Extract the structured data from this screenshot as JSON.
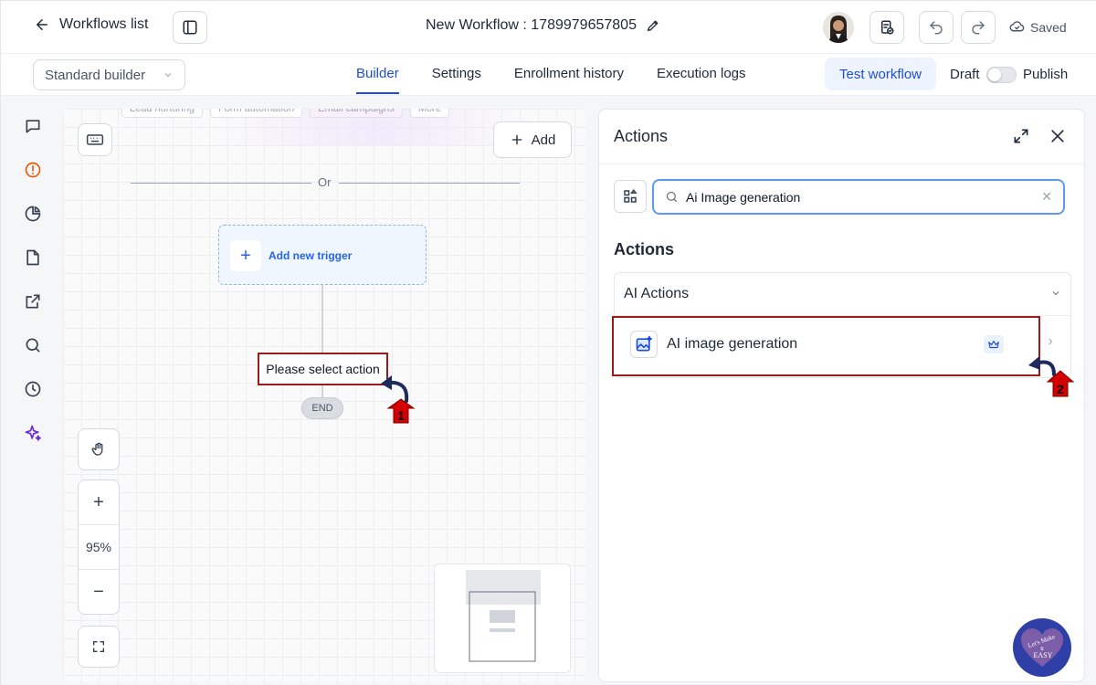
{
  "header": {
    "back_label": "Workflows list",
    "workflow_title": "New Workflow : 1789979657805",
    "saved_label": "Saved"
  },
  "subbar": {
    "builder_select": "Standard builder",
    "tabs": [
      {
        "label": "Builder",
        "active": true
      },
      {
        "label": "Settings",
        "active": false
      },
      {
        "label": "Enrollment history",
        "active": false
      },
      {
        "label": "Execution logs",
        "active": false
      }
    ],
    "test_button": "Test workflow",
    "draft_label": "Draft",
    "publish_label": "Publish",
    "publish_toggle_on": false
  },
  "rail_icons": [
    "chat-icon",
    "alert-icon",
    "pie-chart-icon",
    "file-icon",
    "external-link-icon",
    "search-icon",
    "history-icon",
    "sparkle-icon"
  ],
  "canvas": {
    "template_chips": [
      "Lead nurturing",
      "Form automation",
      "Email campaigns",
      "More"
    ],
    "add_label": "Add",
    "or_label": "Or",
    "trigger_label": "Add new trigger",
    "select_action_label": "Please select action",
    "end_label": "END",
    "zoom_level": "95%",
    "annotation_1": "1"
  },
  "panel": {
    "title": "Actions",
    "search_value": "Ai Image generation",
    "section_heading": "Actions",
    "group_title": "AI Actions",
    "item_label": "AI image generation",
    "annotation_2": "2"
  },
  "colors": {
    "accent": "#1d4ed8",
    "highlight_border": "#9b1b1b",
    "annotation_arrow": "#d40000"
  }
}
